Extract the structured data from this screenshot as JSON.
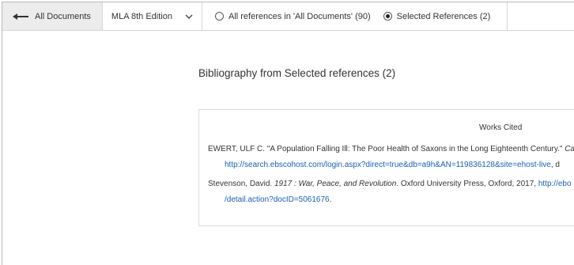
{
  "toolbar": {
    "back_label": "All Documents",
    "style_value": "MLA 8th Edition",
    "radio_all_label": "All references in 'All Documents' (90)",
    "radio_selected_label": "Selected References (2)",
    "selected_option": "Selected References (2)"
  },
  "main": {
    "heading": "Bibliography from Selected references (2)",
    "works_cited_title": "Works Cited",
    "entries": [
      {
        "text": "EWERT, ULF C. \"A Population Falling Ill: The Poor Health of Saxons in the Long Eighteenth Century.\" ",
        "italic": "Ca",
        "url_line": "http://search.ebscohost.com/login.aspx?direct=true&db=a9h&AN=119836128&site=ehost-live",
        "after_url": ", d"
      },
      {
        "text_before": "Stevenson, David. ",
        "italic": "1917 : War, Peace, and Revolution",
        "text_after": ". Oxford University Press, Oxford, 2017, ",
        "url_start": "http://ebo",
        "url_line": "/detail.action?docID=5061676",
        "after_url": "."
      }
    ]
  },
  "icons": {
    "back": "arrow-left-icon",
    "dropdown": "chevron-down-icon"
  },
  "colors": {
    "link": "#1a5fb4",
    "toolbar_back_bg": "#ececec",
    "border": "#d6d6d6"
  }
}
